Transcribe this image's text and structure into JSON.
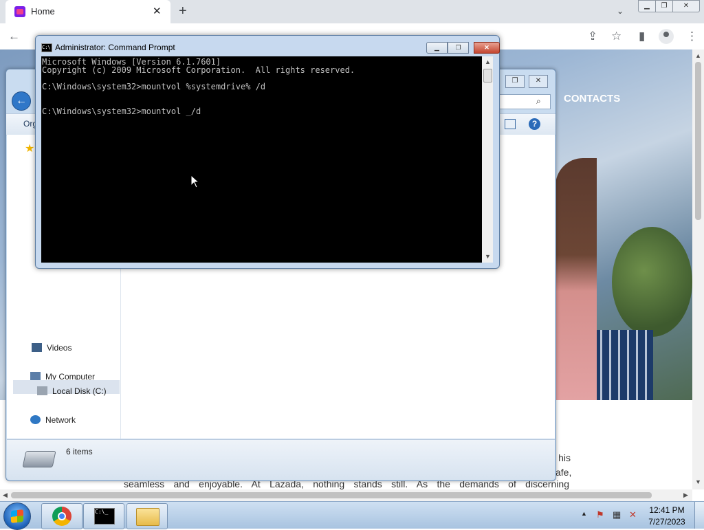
{
  "browser": {
    "tab_title": "Home",
    "tab_close": "✕",
    "new_tab": "+",
    "tab_dropdown": "⌄"
  },
  "webpage": {
    "nav_contacts": "CONTACTS",
    "para_fragments": [
      "his",
      "afe,"
    ],
    "line_text": "seamless and enjoyable. At Lazada, nothing stands still. As the demands of discerning"
  },
  "explorer": {
    "organize": "Org",
    "nav": {
      "videos": "Videos",
      "my_computer": "My Computer",
      "local_disk": "Local Disk (C:)",
      "network": "Network"
    },
    "items_count": "6 items"
  },
  "cmd": {
    "title": "Administrator: Command Prompt",
    "lines": [
      "Microsoft Windows [Version 6.1.7601]",
      "Copyright (c) 2009 Microsoft Corporation.  All rights reserved.",
      "",
      "C:\\Windows\\system32>mountvol %systemdrive% /d",
      "",
      "",
      "C:\\Windows\\system32>mountvol _/d"
    ]
  },
  "taskbar": {
    "time": "12:41 PM",
    "date": "7/27/2023"
  },
  "colors": {
    "cmd_background": "#000000",
    "cmd_text": "#c0c0c0",
    "taskbar": "#a8c3e0"
  },
  "icons": [
    "back-icon",
    "forward-icon",
    "reload-icon",
    "share-icon",
    "star-icon",
    "sidebar-icon",
    "profile-icon",
    "menu-icon",
    "search-icon",
    "help-icon",
    "layout-icon",
    "drive-icon",
    "chrome-icon",
    "cmd-icon",
    "folder-icon",
    "speaker-mute-icon",
    "flag-icon",
    "network-icon"
  ]
}
